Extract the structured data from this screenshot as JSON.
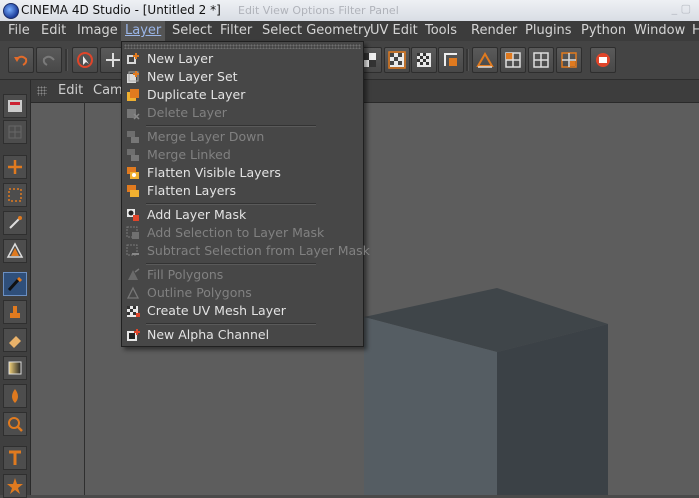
{
  "window": {
    "title": "CINEMA 4D Studio - [Untitled 2 *]",
    "ghost_text": "Edit  View  Options  Filter  Panel",
    "controls": "_  ▢"
  },
  "menubar": {
    "items": [
      "File",
      "Edit",
      "Image",
      "Layer",
      "Select",
      "Filter",
      "Select Geometry",
      "UV Edit",
      "Tools",
      "Render",
      "Plugins",
      "Python",
      "Window",
      "H"
    ],
    "active": "Layer"
  },
  "viewport": {
    "menu": [
      "Edit",
      "Cam"
    ]
  },
  "layer_menu": {
    "items": [
      {
        "label": "New Layer",
        "enabled": true,
        "icon": "new-layer-icon"
      },
      {
        "label": "New Layer Set",
        "enabled": true,
        "icon": "new-layer-set-icon"
      },
      {
        "label": "Duplicate Layer",
        "enabled": true,
        "icon": "duplicate-layer-icon"
      },
      {
        "label": "Delete Layer",
        "enabled": false,
        "icon": "delete-layer-icon"
      },
      {
        "label": "Merge Layer Down",
        "enabled": false,
        "icon": "merge-layer-down-icon"
      },
      {
        "label": "Merge Linked",
        "enabled": false,
        "icon": "merge-linked-icon"
      },
      {
        "label": "Flatten Visible Layers",
        "enabled": true,
        "icon": "flatten-visible-icon"
      },
      {
        "label": "Flatten Layers",
        "enabled": true,
        "icon": "flatten-layers-icon"
      },
      {
        "label": "Add Layer Mask",
        "enabled": true,
        "icon": "add-layer-mask-icon"
      },
      {
        "label": "Add Selection to Layer Mask",
        "enabled": false,
        "icon": "add-selection-mask-icon"
      },
      {
        "label": "Subtract Selection from Layer Mask",
        "enabled": false,
        "icon": "subtract-selection-mask-icon"
      },
      {
        "label": "Fill Polygons",
        "enabled": false,
        "icon": "fill-polygons-icon"
      },
      {
        "label": "Outline Polygons",
        "enabled": false,
        "icon": "outline-polygons-icon"
      },
      {
        "label": "Create UV Mesh Layer",
        "enabled": true,
        "icon": "uv-mesh-layer-icon"
      },
      {
        "label": "New Alpha Channel",
        "enabled": true,
        "icon": "new-alpha-channel-icon"
      }
    ]
  },
  "colors": {
    "menu_bg": "#474747",
    "accent": "#e07a1f",
    "active_menu_text": "#9bb6e8",
    "cube_top": "#3f4549",
    "cube_left": "#545c62",
    "cube_right": "#3b4146"
  }
}
